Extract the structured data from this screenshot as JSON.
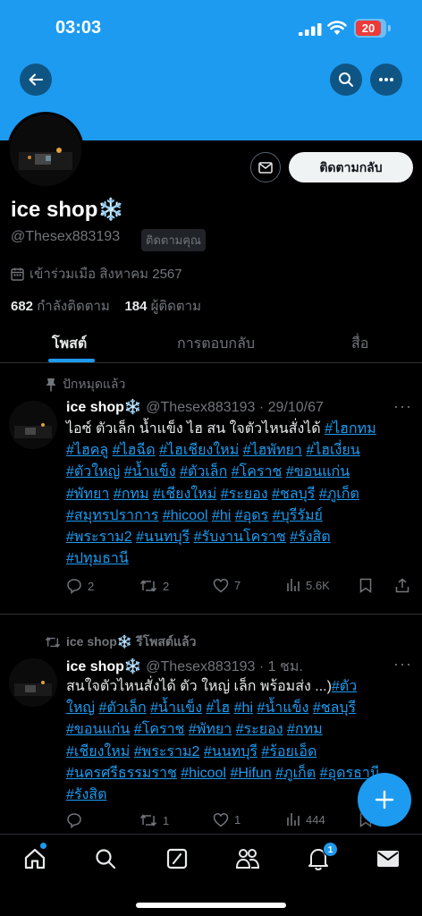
{
  "status_bar": {
    "time": "03:03",
    "battery": "20"
  },
  "profile": {
    "name": "ice shop❄️",
    "handle": "@Thesex883193",
    "follows_you_badge": "ติดตามคุณ",
    "joined": "เข้าร่วมเมือ สิงหาคม 2567",
    "following_count": "682",
    "following_label": "กำลังติดตาม",
    "followers_count": "184",
    "followers_label": "ผู้ติดตาม",
    "follow_back_label": "ติดตามกลับ"
  },
  "tabs": [
    "โพสต์",
    "การตอบกลับ",
    "สื่อ"
  ],
  "tweets": [
    {
      "social_context": "ปักหมุดแล้ว",
      "name": "ice shop❄️",
      "handle": "@Thesex883193",
      "time": "· 29/10/67",
      "lines": [
        [
          {
            "t": "ไอซ์ ตัวเล็ก น้ำแข็ง ไฮ สน ใจตัวไหนสั่งได้ "
          },
          {
            "h": "#ไฮกทม"
          }
        ],
        [
          {
            "h": "#ไฮคลู"
          },
          {
            "t": " "
          },
          {
            "h": "#ไฮฉีด"
          },
          {
            "t": " "
          },
          {
            "h": "#ไฮเชียงใหม่"
          },
          {
            "t": " "
          },
          {
            "h": "#ไฮพัทยา"
          },
          {
            "t": " "
          },
          {
            "h": "#ไฮเงี่ยน"
          }
        ],
        [
          {
            "h": "#ตัวใหญ่"
          },
          {
            "t": " "
          },
          {
            "h": "#น้ำแข็ง"
          },
          {
            "t": " "
          },
          {
            "h": "#ตัวเล็ก"
          },
          {
            "t": " "
          },
          {
            "h": "#โคราช"
          },
          {
            "t": " "
          },
          {
            "h": "#ขอนแก่น"
          }
        ],
        [
          {
            "h": "#พัทยา"
          },
          {
            "t": " "
          },
          {
            "h": "#กทม"
          },
          {
            "t": " "
          },
          {
            "h": "#เชียงใหม่"
          },
          {
            "t": " "
          },
          {
            "h": "#ระยอง"
          },
          {
            "t": " "
          },
          {
            "h": "#ชลบุรี"
          },
          {
            "t": " "
          },
          {
            "h": "#ภูเก็ต"
          }
        ],
        [
          {
            "h": "#สมุทรปราการ"
          },
          {
            "t": " "
          },
          {
            "h": "#hicool"
          },
          {
            "t": " "
          },
          {
            "h": "#hi"
          },
          {
            "t": " "
          },
          {
            "h": "#อุดร"
          },
          {
            "t": " "
          },
          {
            "h": "#บุรีรัมย์"
          }
        ],
        [
          {
            "h": "#พระราม2"
          },
          {
            "t": " "
          },
          {
            "h": "#นนทบุรี"
          },
          {
            "t": " "
          },
          {
            "h": "#รับงานโคราช"
          },
          {
            "t": " "
          },
          {
            "h": "#รังสิต"
          }
        ],
        [
          {
            "h": "#ปทุมธานี"
          }
        ]
      ],
      "replies": "2",
      "retweets": "2",
      "likes": "7",
      "views": "5.6K"
    },
    {
      "social_context": "ice shop❄️ รีโพสต์แล้ว",
      "name": "ice shop❄️",
      "handle": "@Thesex883193",
      "time": "· 1 ชม.",
      "lines": [
        [
          {
            "t": "สนใจตัวไหนสั่งได้ ตัว ใหญ่ เล็ก พร้อมส่ง   ...)"
          },
          {
            "h": "#ตัว"
          }
        ],
        [
          {
            "h": "ใหญ่"
          },
          {
            "t": " "
          },
          {
            "h": "#ตัวเล็ก"
          },
          {
            "t": " "
          },
          {
            "h": "#น้ำแข็ง"
          },
          {
            "t": " "
          },
          {
            "h": "#ไฮ"
          },
          {
            "t": " "
          },
          {
            "h": "#hi"
          },
          {
            "t": " "
          },
          {
            "h": "#น้ำแข็ง"
          },
          {
            "t": " "
          },
          {
            "h": "#ชลบุรี"
          }
        ],
        [
          {
            "h": "#ขอนแก่น"
          },
          {
            "t": " "
          },
          {
            "h": "#โคราช"
          },
          {
            "t": " "
          },
          {
            "h": "#พัทยา"
          },
          {
            "t": " "
          },
          {
            "h": "#ระยอง"
          },
          {
            "t": " "
          },
          {
            "h": "#กทม"
          }
        ],
        [
          {
            "h": "#เชียงใหม่"
          },
          {
            "t": " "
          },
          {
            "h": "#พระราม2"
          },
          {
            "t": " "
          },
          {
            "h": "#นนทบุรี"
          },
          {
            "t": " "
          },
          {
            "h": "#ร้อยเอ็ด"
          }
        ],
        [
          {
            "h": "#นครศรีธรรมราช"
          },
          {
            "t": " "
          },
          {
            "h": "#hicool"
          },
          {
            "t": " "
          },
          {
            "h": "#Hifun"
          },
          {
            "t": " "
          },
          {
            "h": "#ภูเก็ต"
          },
          {
            "t": " "
          },
          {
            "h": "#อุดรธานี"
          }
        ],
        [
          {
            "h": "#รังสิต"
          }
        ]
      ],
      "replies": "",
      "retweets": "1",
      "likes": "1",
      "views": "444"
    }
  ],
  "notifications_badge": "1",
  "colors": {
    "accent": "#1d9bf0",
    "background": "#000000",
    "muted": "#71767b"
  }
}
